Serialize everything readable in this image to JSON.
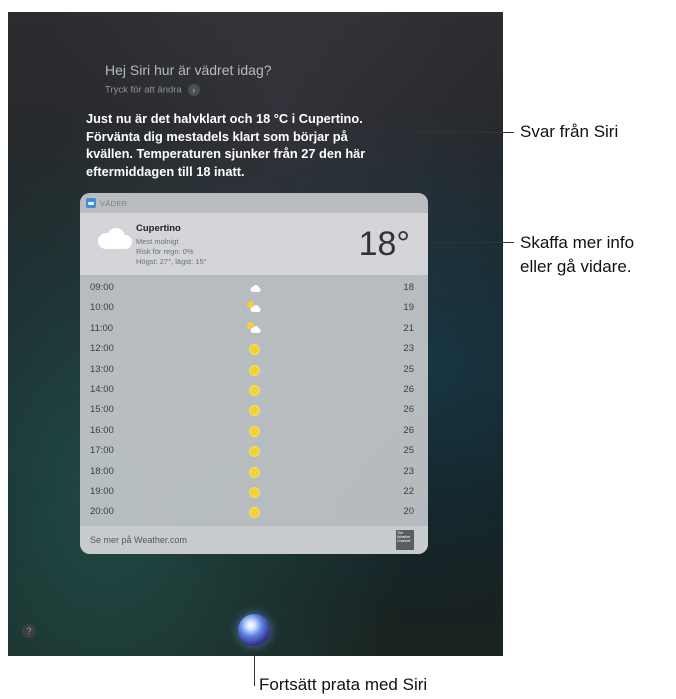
{
  "siri": {
    "query": "Hej Siri hur är vädret idag?",
    "edit_hint": "Tryck för att ändra",
    "answer": "Just nu är det halvklart och 18 °C i Cupertino. Förvänta dig mestadels klart som börjar på kvällen. Temperaturen sjunker från 27 den här eftermiddagen till 18 inatt."
  },
  "weather_card": {
    "app_name": "VÄDER",
    "city": "Cupertino",
    "condition": "Mest molnigt",
    "rain": "Risk för regn: 0%",
    "high_low": "Högst: 27°, lägst: 15°",
    "current_temp": "18°",
    "hours": [
      {
        "time": "09:00",
        "icon": "cloud-icon",
        "temp": "18"
      },
      {
        "time": "10:00",
        "icon": "partly-sunny-icon",
        "temp": "19"
      },
      {
        "time": "11:00",
        "icon": "partly-sunny-icon",
        "temp": "21"
      },
      {
        "time": "12:00",
        "icon": "sun-icon",
        "temp": "23"
      },
      {
        "time": "13:00",
        "icon": "sun-icon",
        "temp": "25"
      },
      {
        "time": "14:00",
        "icon": "sun-icon",
        "temp": "26"
      },
      {
        "time": "15:00",
        "icon": "sun-icon",
        "temp": "26"
      },
      {
        "time": "16:00",
        "icon": "sun-icon",
        "temp": "26"
      },
      {
        "time": "17:00",
        "icon": "sun-icon",
        "temp": "25"
      },
      {
        "time": "18:00",
        "icon": "sun-icon",
        "temp": "23"
      },
      {
        "time": "19:00",
        "icon": "sun-icon",
        "temp": "22"
      },
      {
        "time": "20:00",
        "icon": "sun-icon",
        "temp": "20"
      }
    ],
    "footer_link": "Se mer på Weather.com",
    "logo_text": "The Weather Channel"
  },
  "controls": {
    "help": "?"
  },
  "callouts": {
    "answer": "Svar från Siri",
    "card_line1": "Skaffa mer info",
    "card_line2": "eller gå vidare.",
    "siri_button": "Fortsätt prata med Siri"
  },
  "colors": {
    "sun": "#f3d238",
    "app_icon": "#3e8ee0"
  }
}
